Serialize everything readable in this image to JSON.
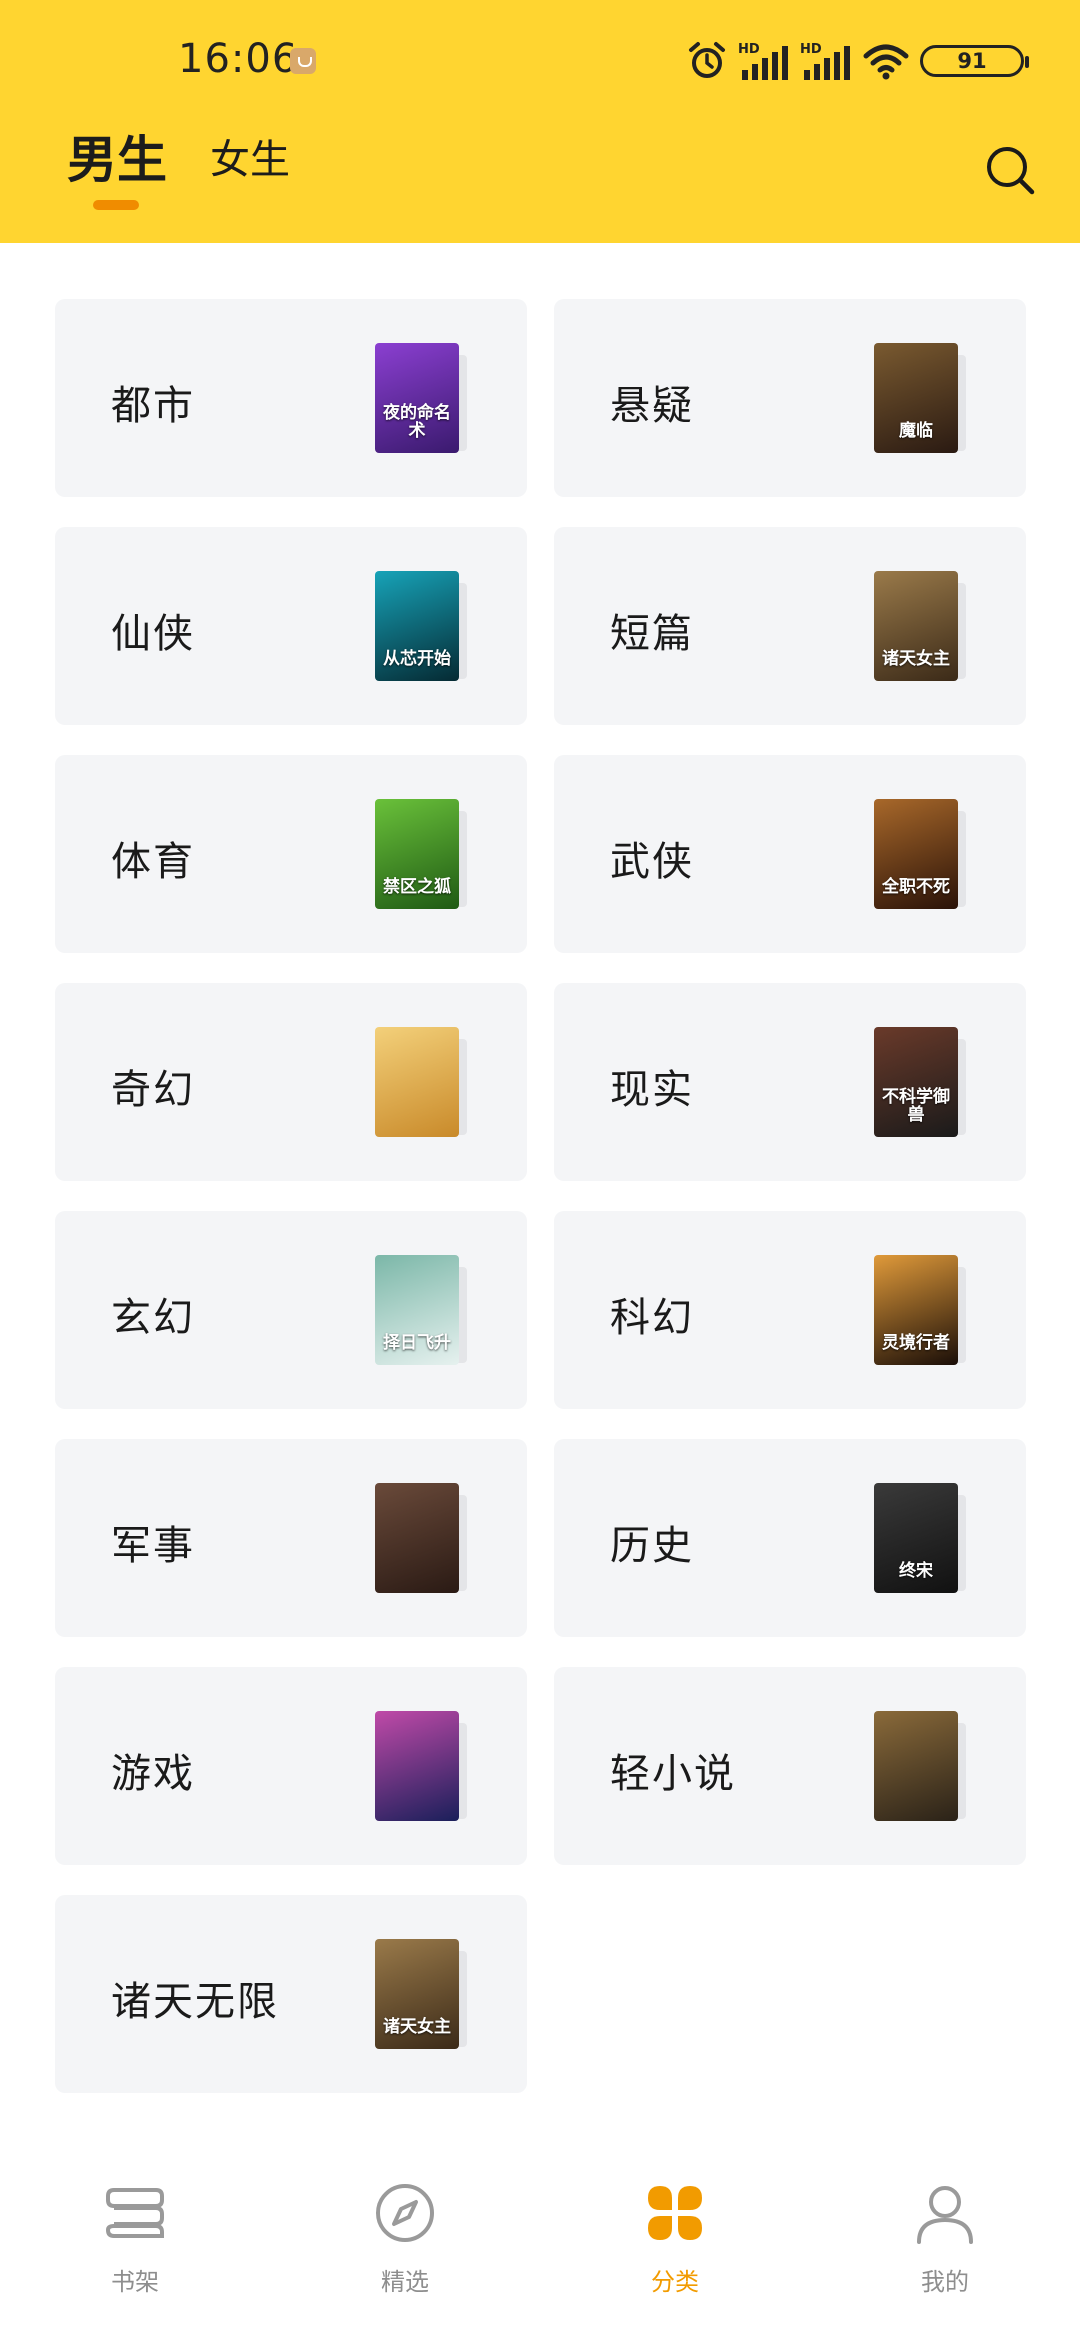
{
  "status_bar": {
    "time": "16:06",
    "battery": "91"
  },
  "tabs": [
    {
      "label": "男生",
      "active": true
    },
    {
      "label": "女生",
      "active": false
    }
  ],
  "search": {
    "icon": "search-icon"
  },
  "categories": [
    {
      "label": "都市",
      "cover_title": "夜的命名术",
      "cover_colors": [
        "#3a1a6e",
        "#8b3fd1"
      ]
    },
    {
      "label": "悬疑",
      "cover_title": "魔临",
      "cover_colors": [
        "#2a1a12",
        "#7a5a30"
      ]
    },
    {
      "label": "仙侠",
      "cover_title": "从芯开始",
      "cover_colors": [
        "#052a33",
        "#17a3b8"
      ]
    },
    {
      "label": "短篇",
      "cover_title": "诸天女主",
      "cover_colors": [
        "#3b2a18",
        "#9a7a4a"
      ]
    },
    {
      "label": "体育",
      "cover_title": "禁区之狐",
      "cover_colors": [
        "#1f5a14",
        "#6ac13a"
      ]
    },
    {
      "label": "武侠",
      "cover_title": "全职不死",
      "cover_colors": [
        "#2a1208",
        "#a8682a"
      ]
    },
    {
      "label": "奇幻",
      "cover_title": "",
      "cover_colors": [
        "#c98a2a",
        "#f3d07a"
      ]
    },
    {
      "label": "现实",
      "cover_title": "不科学御兽",
      "cover_colors": [
        "#1a1a1a",
        "#6a3a2a"
      ]
    },
    {
      "label": "玄幻",
      "cover_title": "择日飞升",
      "cover_colors": [
        "#e6f1ef",
        "#7bb7a8"
      ]
    },
    {
      "label": "科幻",
      "cover_title": "灵境行者",
      "cover_colors": [
        "#1a0e08",
        "#e09a3a"
      ]
    },
    {
      "label": "军事",
      "cover_title": "",
      "cover_colors": [
        "#2a1a14",
        "#6a4a3a"
      ]
    },
    {
      "label": "历史",
      "cover_title": "终宋",
      "cover_colors": [
        "#111111",
        "#3a3a3a"
      ]
    },
    {
      "label": "游戏",
      "cover_title": "",
      "cover_colors": [
        "#1a1f5a",
        "#c04aa8"
      ]
    },
    {
      "label": "轻小说",
      "cover_title": "",
      "cover_colors": [
        "#2a2218",
        "#8a6a3a"
      ]
    },
    {
      "label": "诸天无限",
      "cover_title": "诸天女主",
      "cover_colors": [
        "#3b2a18",
        "#9a7a4a"
      ]
    }
  ],
  "bottom_nav": [
    {
      "label": "书架",
      "icon": "bookshelf-icon",
      "active": false
    },
    {
      "label": "精选",
      "icon": "compass-icon",
      "active": false
    },
    {
      "label": "分类",
      "icon": "category-grid-icon",
      "active": true
    },
    {
      "label": "我的",
      "icon": "profile-icon",
      "active": false
    }
  ],
  "colors": {
    "header": "#FFD530",
    "accent": "#F29B00",
    "card_bg": "#F4F5F7"
  }
}
